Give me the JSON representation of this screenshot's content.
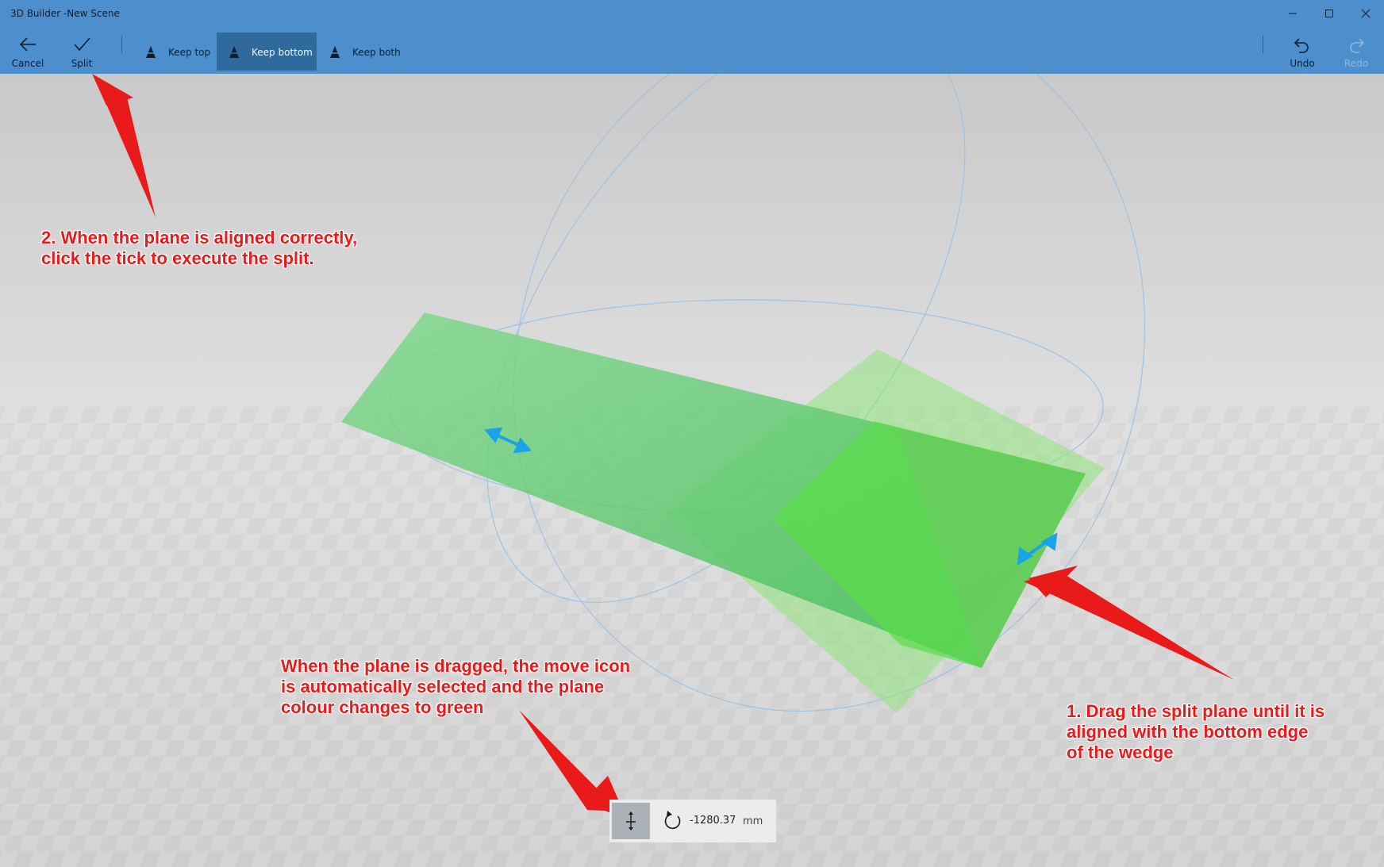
{
  "window": {
    "title": "3D Builder -New Scene",
    "controls": [
      "minimize-icon",
      "maximize-icon",
      "close-icon"
    ]
  },
  "toolbar": {
    "cancel_label": "Cancel",
    "split_label": "Split",
    "modes": [
      {
        "label": "Keep top",
        "icon": "keep-top-icon",
        "selected": false
      },
      {
        "label": "Keep bottom",
        "icon": "keep-bottom-icon",
        "selected": true
      },
      {
        "label": "Keep both",
        "icon": "keep-both-icon",
        "selected": false
      }
    ],
    "undo_label": "Undo",
    "redo_label": "Redo",
    "redo_enabled": false
  },
  "annotations": [
    {
      "id": "note-split",
      "text": "2. When the plane is aligned correctly,\nclick the tick to execute the split."
    },
    {
      "id": "note-move",
      "text": "When the plane is dragged, the move icon\nis automatically selected and the plane\ncolour changes to green"
    },
    {
      "id": "note-drag",
      "text": "1. Drag the split plane until it is\naligned with the bottom edge\nof the wedge"
    }
  ],
  "bottom_panel": {
    "active_tool": "move-icon",
    "rotate_icon": "rotate-icon",
    "offset_value": "-1280.37",
    "unit": "mm"
  },
  "colors": {
    "titlebar": "#4c8fcc",
    "selected_mode": "#2e6b9c",
    "plane_green": "#4fcf4f",
    "wedge_green": "#55dd44",
    "handle_blue": "#1aa3e8",
    "annotation_red": "#e81a1a"
  }
}
